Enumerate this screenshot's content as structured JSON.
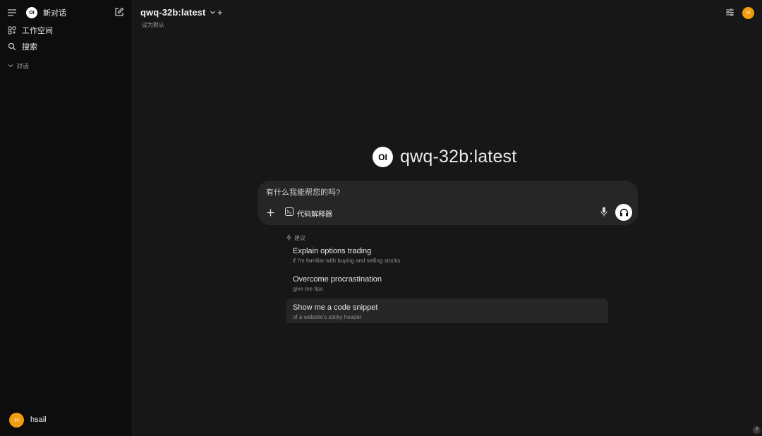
{
  "sidebar": {
    "logo_text": "OI",
    "new_chat_label": "新对话",
    "items": [
      {
        "label": "工作空间",
        "icon": "workspace-grid-icon"
      },
      {
        "label": "搜索",
        "icon": "search-icon"
      }
    ],
    "section_label": "对话",
    "user": {
      "avatar_initial": "H",
      "name": "hsail"
    }
  },
  "header": {
    "model_name": "qwq-32b:latest",
    "add_model_label": "+",
    "set_default_label": "设为默认",
    "avatar_initial": "H"
  },
  "hero": {
    "logo_text": "OI",
    "title": "qwq-32b:latest"
  },
  "composer": {
    "placeholder": "有什么我能帮您的吗?",
    "tool_label": "代码解释器"
  },
  "suggestions": {
    "header": "建议",
    "items": [
      {
        "title": "Explain options trading",
        "subtitle": "if I'm familiar with buying and selling stocks"
      },
      {
        "title": "Overcome procrastination",
        "subtitle": "give me tips"
      },
      {
        "title": "Show me a code snippet",
        "subtitle": "of a website's sticky header"
      }
    ]
  },
  "help_label": "?",
  "colors": {
    "background": "#171717",
    "sidebar": "#0d0d0d",
    "input": "#262626",
    "avatar": "#f29d0f"
  }
}
